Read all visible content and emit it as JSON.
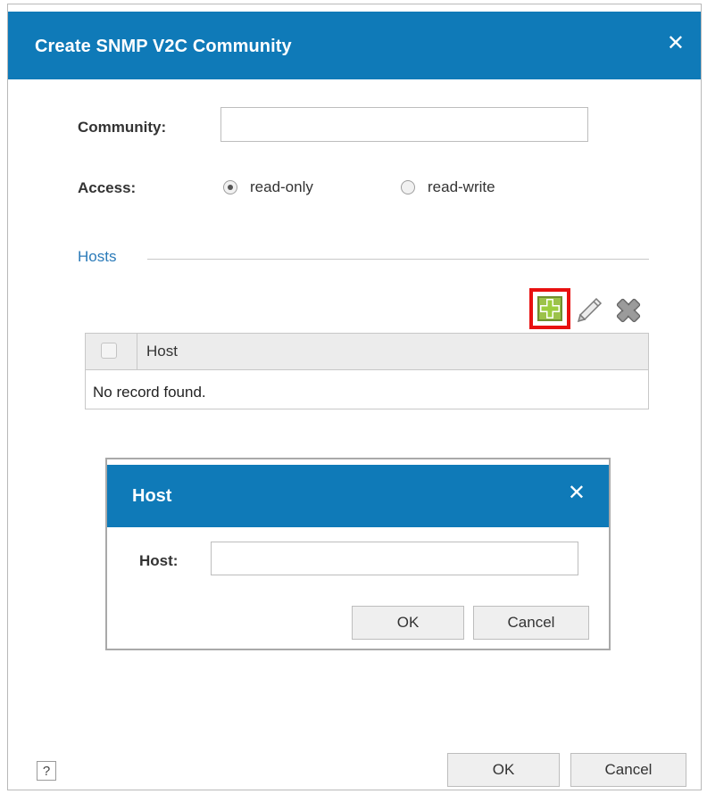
{
  "dialog": {
    "title": "Create SNMP V2C Community",
    "close_glyph": "✕"
  },
  "form": {
    "community_label": "Community:",
    "community_value": "",
    "access_label": "Access:",
    "access_options": [
      {
        "label": "read-only",
        "checked": true
      },
      {
        "label": "read-write",
        "checked": false
      }
    ]
  },
  "hosts": {
    "section_title": "Hosts",
    "toolbar": {
      "add_icon": "add-icon",
      "edit_icon": "pencil-icon",
      "delete_icon": "delete-icon"
    },
    "table": {
      "columns": [
        "Host"
      ],
      "empty_message": "No record found."
    }
  },
  "host_dialog": {
    "title": "Host",
    "close_glyph": "✕",
    "host_label": "Host:",
    "host_value": "",
    "ok_label": "OK",
    "cancel_label": "Cancel"
  },
  "footer": {
    "help_label": "?",
    "ok_label": "OK",
    "cancel_label": "Cancel"
  },
  "colors": {
    "titlebar": "#0f7ab8",
    "section_title": "#2b7bb9",
    "add_highlight": "#e81010"
  }
}
